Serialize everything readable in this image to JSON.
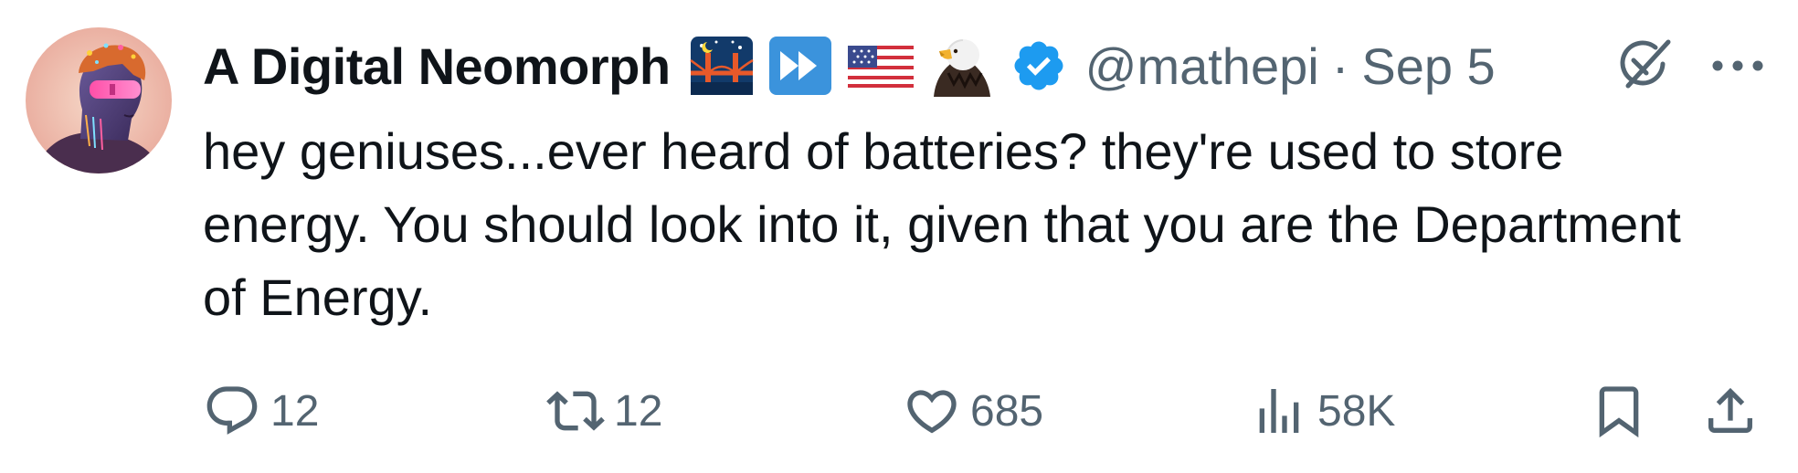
{
  "author": {
    "display_name": "A Digital Neomorph",
    "handle": "@mathepi",
    "separator": "·",
    "date": "Sep 5",
    "verified": true,
    "avatar_icon": "cyberpunk-portrait-avatar",
    "name_emojis": [
      "bridge-at-night-emoji",
      "fast-forward-emoji",
      "us-flag-emoji",
      "eagle-emoji"
    ]
  },
  "tweet": {
    "text": "hey geniuses...ever heard of batteries? they're used to store energy. You should look into it, given that you are the Department of Energy."
  },
  "actions": {
    "reply_count": "12",
    "repost_count": "12",
    "like_count": "685",
    "view_count": "58K"
  },
  "colors": {
    "text": "#0f1419",
    "secondary": "#536471",
    "verified_blue": "#1d9bf0"
  }
}
